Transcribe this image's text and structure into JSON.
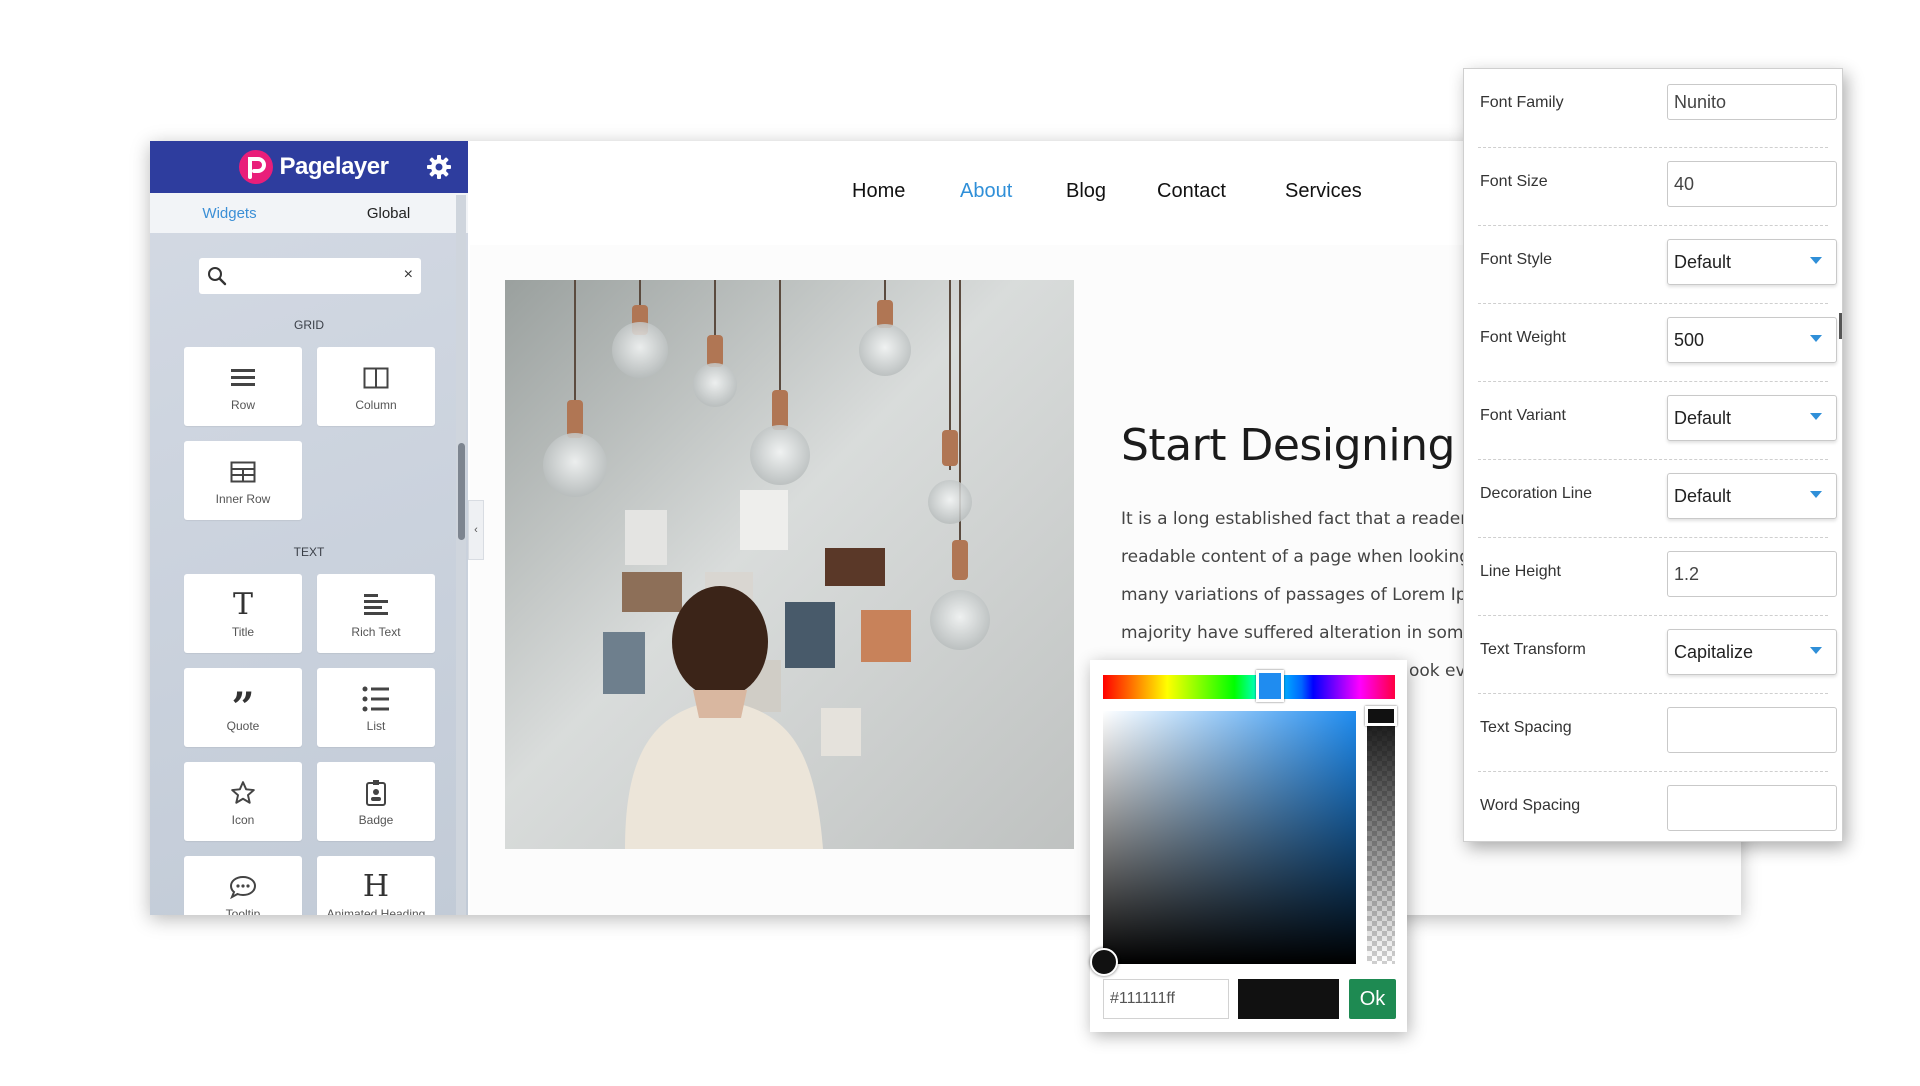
{
  "sidebar": {
    "brand": "Pagelayer",
    "tabs": [
      {
        "label": "Widgets",
        "active": true
      },
      {
        "label": "Global",
        "active": false
      }
    ],
    "search": {
      "value": "",
      "clear": "×"
    },
    "sections": {
      "grid": "GRID",
      "text": "TEXT"
    },
    "widgets": [
      {
        "label": "Row",
        "icon": "rows-icon"
      },
      {
        "label": "Column",
        "icon": "columns-icon"
      },
      {
        "label": "Inner Row",
        "icon": "table-icon"
      },
      {
        "label": "Title",
        "icon": "title-icon"
      },
      {
        "label": "Rich Text",
        "icon": "rich-text-icon"
      },
      {
        "label": "Quote",
        "icon": "quote-icon"
      },
      {
        "label": "List",
        "icon": "list-icon"
      },
      {
        "label": "Icon",
        "icon": "star-icon"
      },
      {
        "label": "Badge",
        "icon": "badge-icon"
      },
      {
        "label": "Tooltip",
        "icon": "speech-bubble-icon"
      },
      {
        "label": "Animated Heading",
        "icon": "heading-icon"
      }
    ],
    "collapse_glyph": "‹",
    "brand_color": "#2e3d9e"
  },
  "site": {
    "nav": [
      {
        "label": "Home",
        "active": false
      },
      {
        "label": "About",
        "active": true
      },
      {
        "label": "Blog",
        "active": false
      },
      {
        "label": "Contact",
        "active": false
      },
      {
        "label": "Services",
        "active": false
      }
    ],
    "accent": "#2f8fd8",
    "heading": "Start Designing",
    "paragraph_lines": [
      "It is a long established fact that a reader",
      "readable content of a page when looking",
      "many variations of passages of Lorem Ips",
      "majority have suffered alteration in some",
      "ook ev"
    ]
  },
  "typography": {
    "rows": [
      {
        "label": "Font Family",
        "value": "Nunito",
        "type": "text"
      },
      {
        "label": "Font Size",
        "value": "40",
        "type": "text"
      },
      {
        "label": "Font Style",
        "value": "Default",
        "type": "select"
      },
      {
        "label": "Font Weight",
        "value": "500",
        "type": "select"
      },
      {
        "label": "Font Variant",
        "value": "Default",
        "type": "select"
      },
      {
        "label": "Decoration Line",
        "value": "Default",
        "type": "select"
      },
      {
        "label": "Line Height",
        "value": "1.2",
        "type": "text"
      },
      {
        "label": "Text Transform",
        "value": "Capitalize",
        "type": "select"
      },
      {
        "label": "Text Spacing",
        "value": "",
        "type": "text"
      },
      {
        "label": "Word Spacing",
        "value": "",
        "type": "text"
      }
    ]
  },
  "color_picker": {
    "hex": "#111111ff",
    "swatch_color": "#111111",
    "hue_color": "#1f8cf0",
    "ok_label": "Ok",
    "ok_color": "#1e8a52"
  }
}
